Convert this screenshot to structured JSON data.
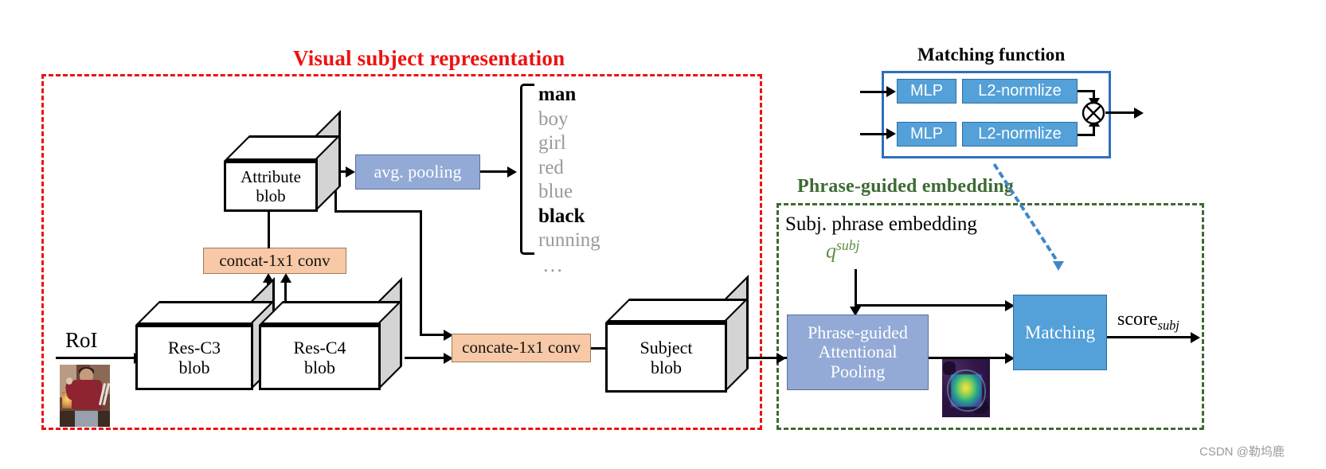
{
  "regions": {
    "visual_subject": {
      "title": "Visual subject representation",
      "color": "#ee1111"
    },
    "matching_function": {
      "title": "Matching function",
      "color": "#2f6fbe"
    },
    "phrase_guided": {
      "title": "Phrase-guided embedding",
      "color": "#3d6b33"
    }
  },
  "left": {
    "roi_label": "RoI",
    "res_c3": {
      "line1": "Res-C3",
      "line2": "blob"
    },
    "res_c4": {
      "line1": "Res-C4",
      "line2": "blob"
    },
    "concat_conv": "concat-1x1  conv",
    "attribute_blob": {
      "line1": "Attribute",
      "line2": "blob"
    },
    "avg_pooling": "avg. pooling",
    "concate_conv": "concate-1x1  conv",
    "subject_blob": {
      "line1": "Subject",
      "line2": "blob"
    },
    "attributes": [
      {
        "text": "man",
        "emphasis": "strong"
      },
      {
        "text": "boy",
        "emphasis": "dim"
      },
      {
        "text": "girl",
        "emphasis": "dim"
      },
      {
        "text": "red",
        "emphasis": "dim"
      },
      {
        "text": "blue",
        "emphasis": "dim"
      },
      {
        "text": "black",
        "emphasis": "strong"
      },
      {
        "text": "running",
        "emphasis": "dim"
      }
    ],
    "attributes_ellipsis": "…"
  },
  "matching_function": {
    "rows": [
      {
        "mlp": "MLP",
        "norm": "L2-normlize"
      },
      {
        "mlp": "MLP",
        "norm": "L2-normlize"
      }
    ],
    "operator": "⊗"
  },
  "right": {
    "subj_phrase_label": "Subj. phrase embedding",
    "q_symbol": {
      "base": "q",
      "superscript": "subj",
      "color": "#5f8d3f"
    },
    "attentional_pooling": {
      "line1": "Phrase-guided",
      "line2": "Attentional",
      "line3": "Pooling"
    },
    "matching_box": "Matching",
    "score": {
      "base": "score",
      "subscript": "subj"
    }
  },
  "colors": {
    "orange_box": "#f7c9a6",
    "periwinkle_box": "#93aad6",
    "blue_box": "#54a0d8",
    "red_dashed": "#ee1111",
    "green_dashed": "#3d6b33",
    "blue_solid": "#2f6fbe",
    "cube_side": "#d4d4d4"
  },
  "watermark": "CSDN @勒坞鹿"
}
